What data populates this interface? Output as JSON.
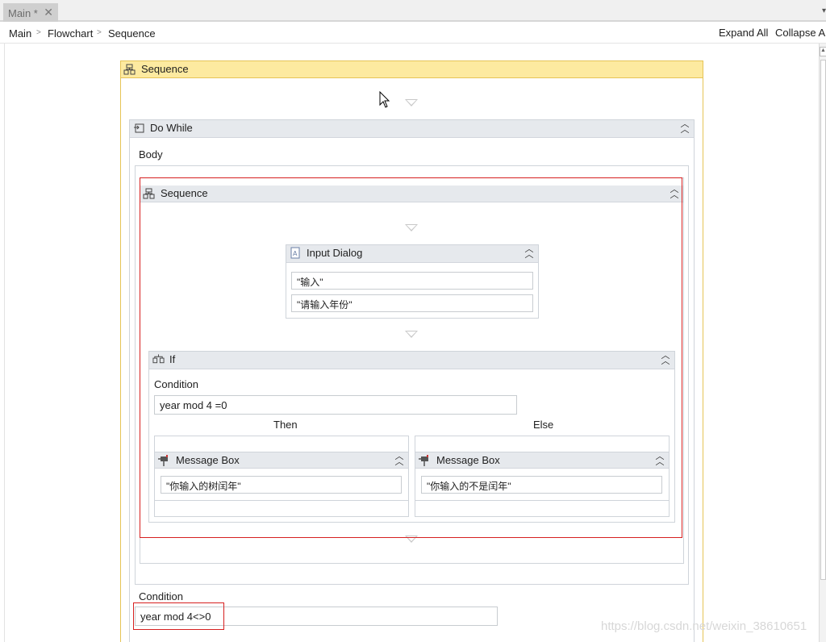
{
  "tab": {
    "title": "Main *",
    "close_glyph": "✕"
  },
  "breadcrumb": [
    {
      "label": "Main"
    },
    {
      "label": "Flowchart"
    },
    {
      "label": "Sequence"
    }
  ],
  "breadcrumb_separator": ">",
  "toolbar": {
    "expand_all": "Expand All",
    "collapse_all": "Collapse Al"
  },
  "outer_sequence": {
    "title": "Sequence"
  },
  "do_while": {
    "title": "Do While",
    "body_label": "Body",
    "condition_label": "Condition",
    "condition_value": "year mod 4<>0"
  },
  "inner_sequence": {
    "title": "Sequence"
  },
  "input_dialog": {
    "title": "Input Dialog",
    "field_1": "\"输入\"",
    "field_2": "\"请输入年份\""
  },
  "if_activity": {
    "title": "If",
    "condition_label": "Condition",
    "condition_value": "year mod 4 =0",
    "then_label": "Then",
    "else_label": "Else",
    "then_box": {
      "title": "Message Box",
      "text": "\"你输入的树闰年\""
    },
    "else_box": {
      "title": "Message Box",
      "text": "\"你输入的不是闰年\""
    }
  },
  "watermark": "https://blog.csdn.net/weixin_38610651",
  "icons": {
    "collapse": "double-chevron-up-icon",
    "sequence": "sequence-icon",
    "do_while": "do-while-icon",
    "input_dialog": "input-dialog-icon",
    "if": "if-icon",
    "message_box": "message-box-icon"
  },
  "colors": {
    "outer_sequence_header": "#fdeaa0",
    "outer_sequence_border": "#e6c456",
    "highlight_red": "#d62020",
    "header_gray": "#e6e9ed"
  }
}
